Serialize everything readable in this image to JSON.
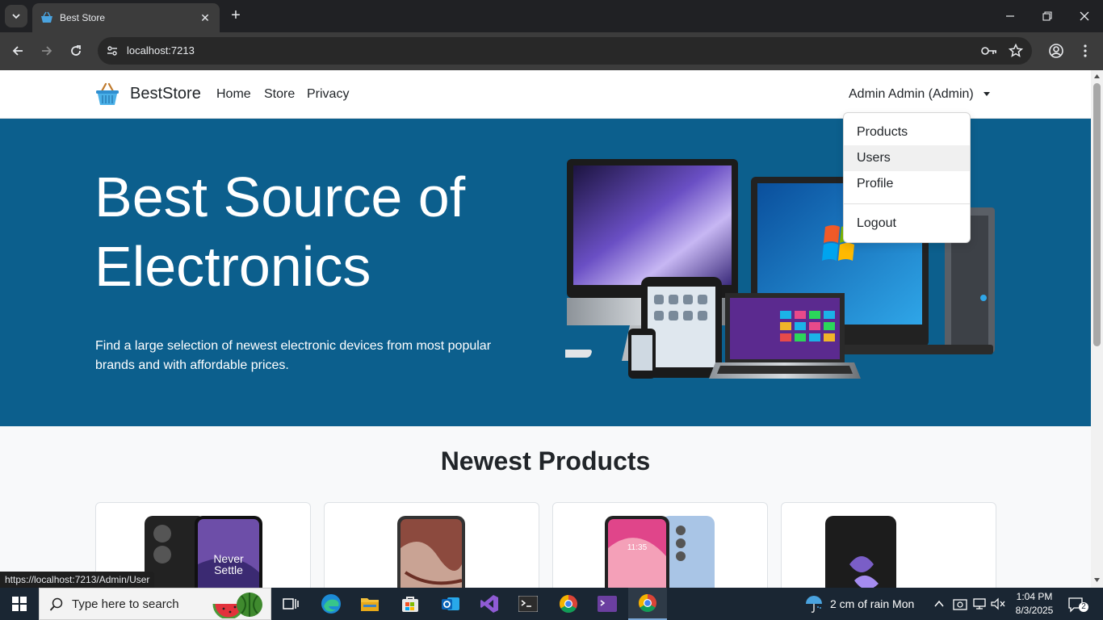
{
  "browser": {
    "tab_title": "Best Store",
    "url": "localhost:7213",
    "status_url": "https://localhost:7213/Admin/User"
  },
  "site": {
    "brand": "BestStore",
    "nav": [
      "Home",
      "Store",
      "Privacy"
    ],
    "user_menu_label": "Admin Admin (Admin)",
    "dropdown_items": [
      "Products",
      "Users",
      "Profile"
    ],
    "dropdown_logout": "Logout"
  },
  "hero": {
    "title": "Best Source of Electronics",
    "text": "Find a large selection of newest electronic devices from most popular brands and with affordable prices.",
    "bg_color": "#0c5f8d"
  },
  "products_section": {
    "title": "Newest Products",
    "card_images": [
      "phone-never-settle",
      "phone-red-pattern",
      "phone-pink-blue",
      "phone-foldable-black"
    ]
  },
  "taskbar": {
    "search_placeholder": "Type here to search",
    "weather": "2 cm of rain Mon",
    "time": "1:04 PM",
    "date": "8/3/2025",
    "notification_count": "2"
  }
}
